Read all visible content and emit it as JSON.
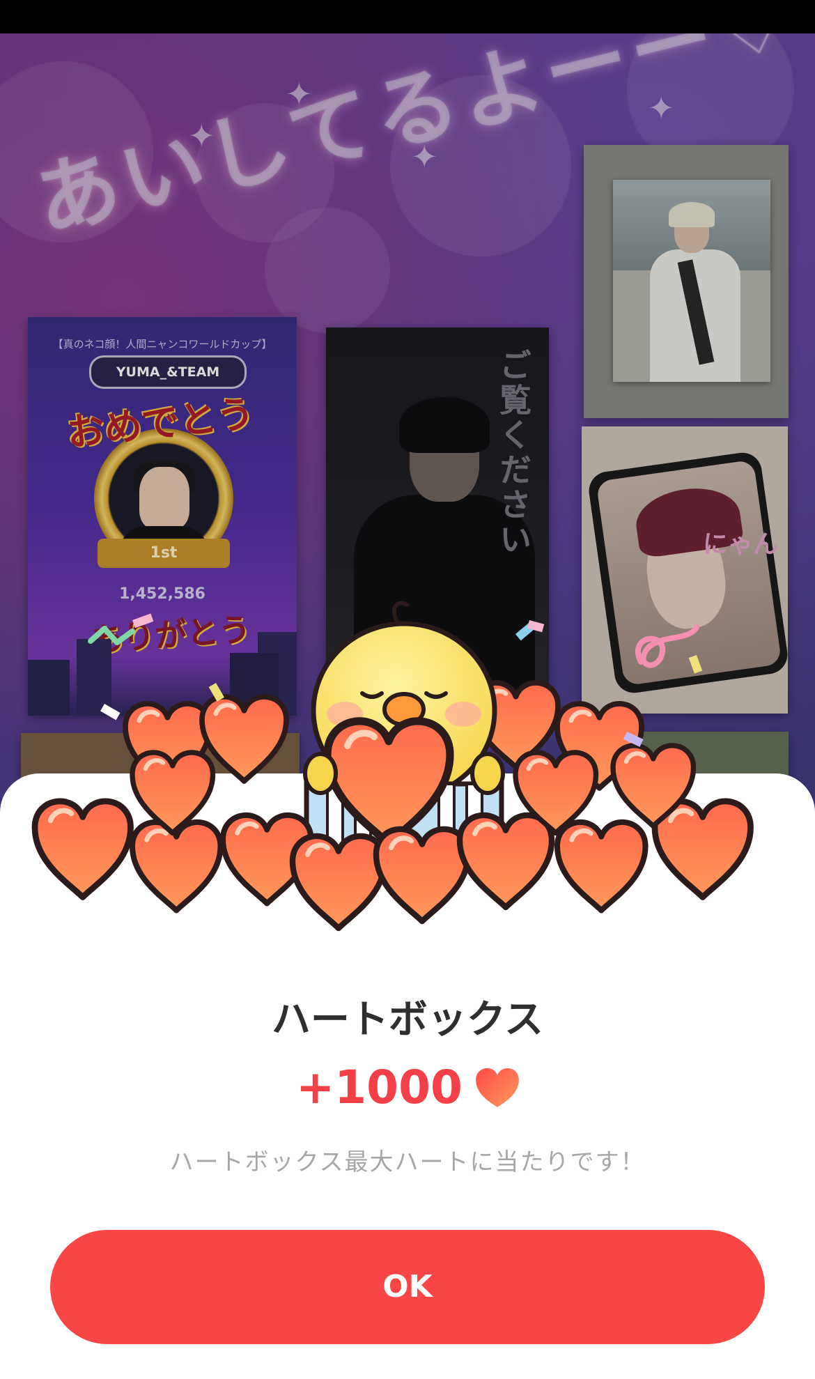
{
  "background": {
    "banner_text": "あいしてるよーー♡",
    "card_1": {
      "caption": "【真のネコ顔！人間ニャンコワールドカップ】",
      "name_pill": "YUMA_&TEAM",
      "congrats": "おめでとう",
      "rank": "1st",
      "votes": "1,452,586",
      "thanks": "ありがとう"
    },
    "card_2": {
      "vertical_text": "ご覧ください"
    },
    "card_4": {
      "sticker_text": "にゃん"
    }
  },
  "modal": {
    "illustration_icon": "chick-with-hearts",
    "title": "ハートボックス",
    "reward_amount": "+1000",
    "reward_icon": "heart-icon",
    "message": "ハートボックス最大ハートに当たりです！",
    "ok_label": "OK"
  },
  "colors": {
    "accent": "#F94543",
    "reward_text": "#F23F48",
    "title_text": "#2E2E2E",
    "message_text": "#A7A7A7"
  }
}
